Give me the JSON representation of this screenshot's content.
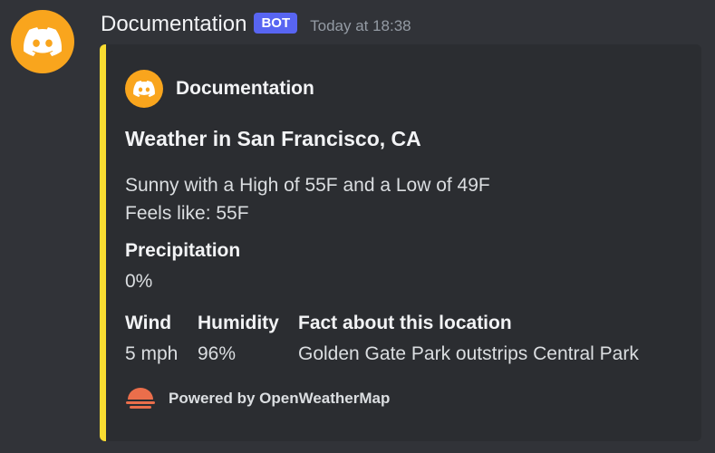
{
  "message": {
    "username": "Documentation",
    "bot_tag": "BOT",
    "timestamp": "Today at 18:38",
    "avatar_icon": "discord-logo-icon",
    "avatar_color": "#f9a51d"
  },
  "embed": {
    "accent_color": "#f9dc31",
    "author": {
      "name": "Documentation",
      "icon": "discord-logo-icon"
    },
    "title": "Weather in San Francisco, CA",
    "description_lines": [
      "Sunny with a High of 55F and a Low of 49F",
      "Feels like: 55F"
    ],
    "fields": [
      {
        "name": "Precipitation",
        "value": "0%"
      },
      {
        "name": "Wind",
        "value": "5 mph"
      },
      {
        "name": "Humidity",
        "value": "96%"
      },
      {
        "name": "Fact about this location",
        "value": "Golden Gate Park outstrips Central Park"
      }
    ],
    "footer": {
      "text": "Powered by OpenWeatherMap",
      "icon": "openweathermap-sun-icon",
      "icon_color": "#eb6e4b"
    }
  }
}
